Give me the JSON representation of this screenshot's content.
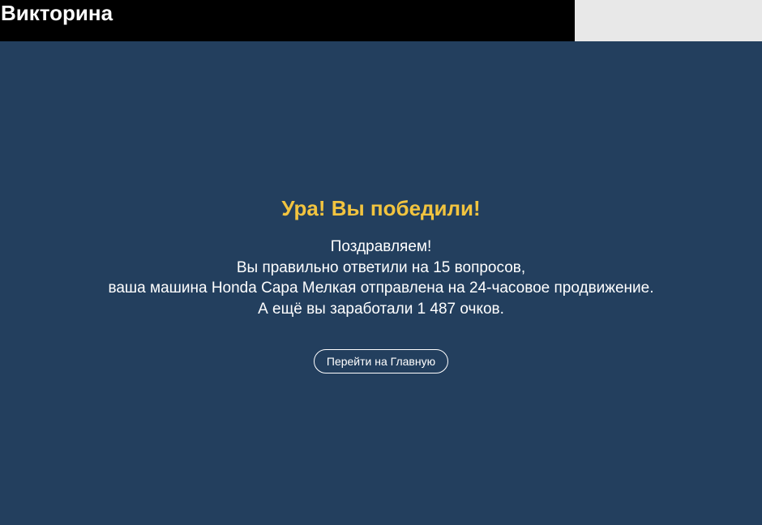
{
  "header": {
    "title": "Викторина",
    "colors": {
      "title_bg": "#000000",
      "side_bg": "#e8e8e8"
    }
  },
  "main": {
    "background": "#233f5e",
    "headline": "Ура! Вы победили!",
    "headline_color": "#f2c43f",
    "message_lines": [
      "Поздравляем!",
      "Вы правильно ответили на 15 вопросов,",
      "ваша машина Honda Capa Мелкая отправлена на 24-часовое продвижение.",
      "А ещё вы заработали 1 487 очков."
    ],
    "home_button_label": "Перейти на Главную"
  }
}
